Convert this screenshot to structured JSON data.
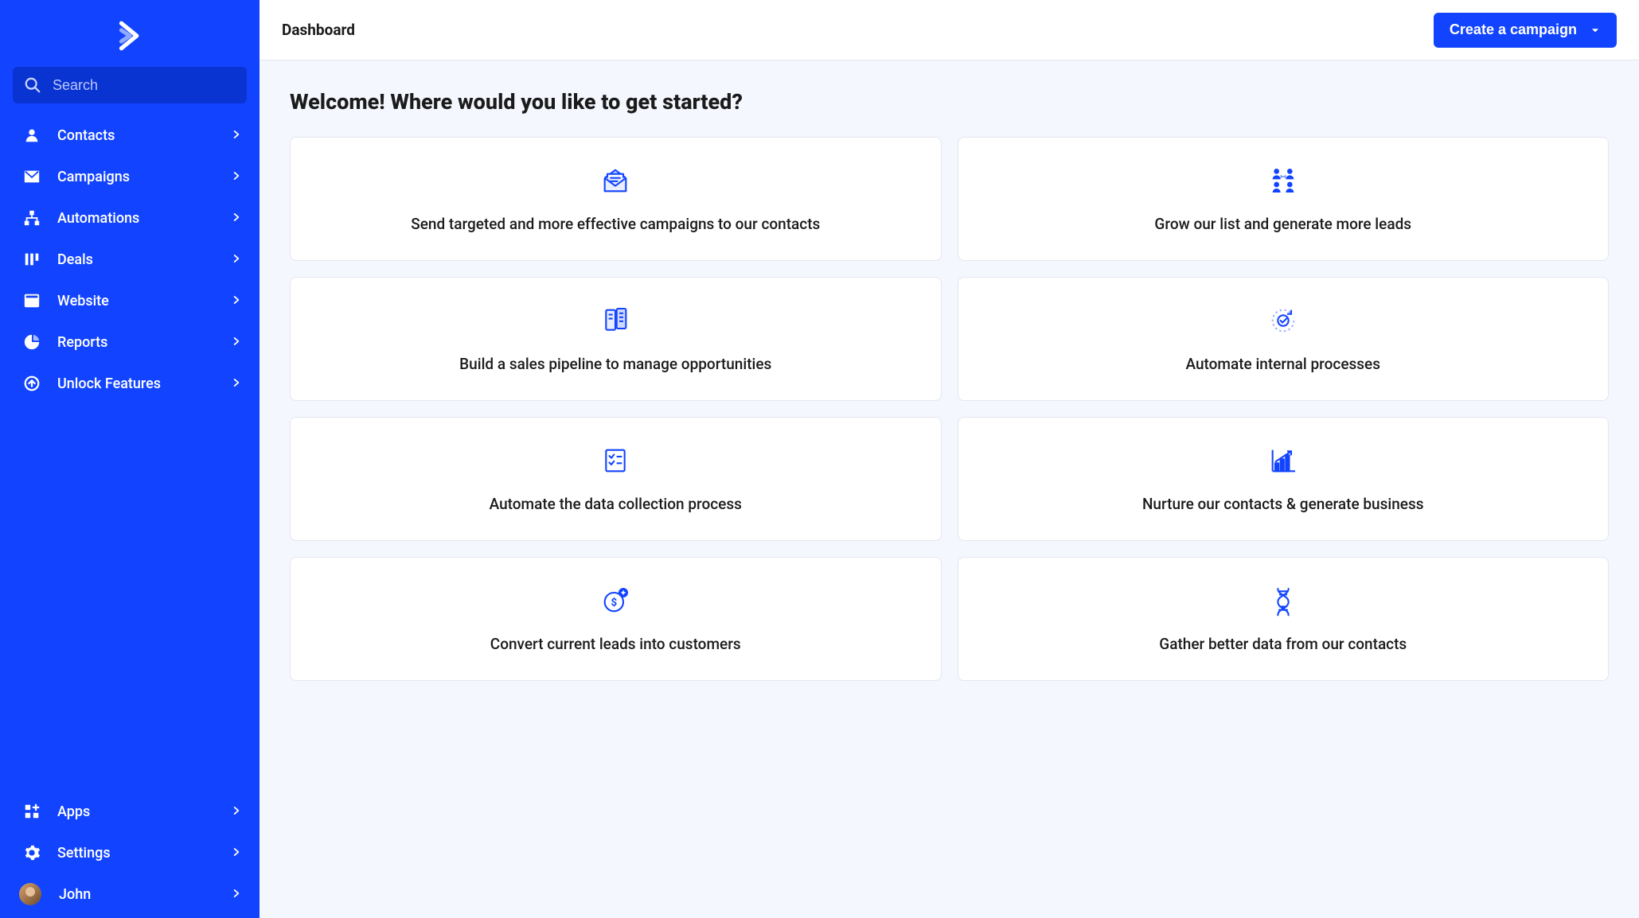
{
  "sidebar": {
    "search_placeholder": "Search",
    "nav_top": [
      {
        "icon": "user-icon",
        "label": "Contacts"
      },
      {
        "icon": "mail-icon",
        "label": "Campaigns"
      },
      {
        "icon": "automation-icon",
        "label": "Automations"
      },
      {
        "icon": "deals-icon",
        "label": "Deals"
      },
      {
        "icon": "website-icon",
        "label": "Website"
      },
      {
        "icon": "reports-icon",
        "label": "Reports"
      },
      {
        "icon": "unlock-icon",
        "label": "Unlock Features"
      }
    ],
    "nav_bottom": [
      {
        "icon": "apps-icon",
        "label": "Apps"
      },
      {
        "icon": "settings-icon",
        "label": "Settings"
      }
    ],
    "user": {
      "name": "John"
    }
  },
  "header": {
    "page_title": "Dashboard",
    "primary_button": "Create a campaign"
  },
  "main": {
    "heading": "Welcome! Where would you like to get started?",
    "cards": [
      {
        "icon": "envelope-open-icon",
        "label": "Send targeted and more effective campaigns to our contacts"
      },
      {
        "icon": "people-connect-icon",
        "label": "Grow our list and generate more leads"
      },
      {
        "icon": "pipeline-icon",
        "label": "Build a sales pipeline to manage opportunities"
      },
      {
        "icon": "gear-cycle-icon",
        "label": "Automate internal processes"
      },
      {
        "icon": "checklist-icon",
        "label": "Automate the data collection process"
      },
      {
        "icon": "growth-chart-icon",
        "label": "Nurture our contacts & generate business"
      },
      {
        "icon": "dollar-plus-icon",
        "label": "Convert current leads into customers"
      },
      {
        "icon": "dna-icon",
        "label": "Gather better data from our contacts"
      }
    ]
  }
}
